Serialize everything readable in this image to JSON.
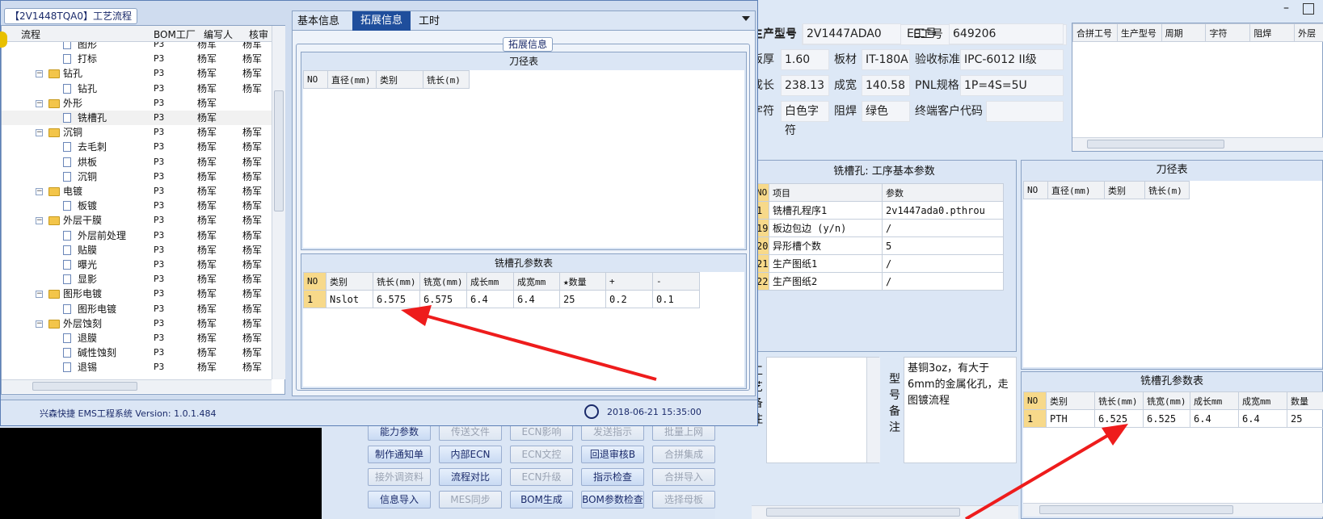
{
  "left_window": {
    "title": "【2V1448TQA0】工艺流程",
    "tree_headers": [
      "流程",
      "BOM工厂",
      "编写人",
      "核审"
    ],
    "tree_rows": [
      {
        "level": 2,
        "kind": "doc",
        "name": "图形",
        "bom": "P3",
        "writer": "杨军",
        "review": "杨军"
      },
      {
        "level": 2,
        "kind": "doc",
        "name": "打标",
        "bom": "P3",
        "writer": "杨军",
        "review": "杨军"
      },
      {
        "level": 1,
        "kind": "folder",
        "name": "钻孔",
        "bom": "P3",
        "writer": "杨军",
        "review": "杨军"
      },
      {
        "level": 2,
        "kind": "doc",
        "name": "钻孔",
        "bom": "P3",
        "writer": "杨军",
        "review": "杨军"
      },
      {
        "level": 1,
        "kind": "folder",
        "name": "外形",
        "bom": "P3",
        "writer": "杨军",
        "review": ""
      },
      {
        "level": 2,
        "kind": "doc",
        "name": "铣槽孔",
        "bom": "P3",
        "writer": "杨军",
        "review": "",
        "selected": true
      },
      {
        "level": 1,
        "kind": "folder",
        "name": "沉铜",
        "bom": "P3",
        "writer": "杨军",
        "review": "杨军"
      },
      {
        "level": 2,
        "kind": "doc",
        "name": "去毛刺",
        "bom": "P3",
        "writer": "杨军",
        "review": "杨军"
      },
      {
        "level": 2,
        "kind": "doc",
        "name": "烘板",
        "bom": "P3",
        "writer": "杨军",
        "review": "杨军"
      },
      {
        "level": 2,
        "kind": "doc",
        "name": "沉铜",
        "bom": "P3",
        "writer": "杨军",
        "review": "杨军"
      },
      {
        "level": 1,
        "kind": "folder",
        "name": "电镀",
        "bom": "P3",
        "writer": "杨军",
        "review": "杨军"
      },
      {
        "level": 2,
        "kind": "doc",
        "name": "板镀",
        "bom": "P3",
        "writer": "杨军",
        "review": "杨军"
      },
      {
        "level": 1,
        "kind": "folder",
        "name": "外层干膜",
        "bom": "P3",
        "writer": "杨军",
        "review": "杨军"
      },
      {
        "level": 2,
        "kind": "doc",
        "name": "外层前处理",
        "bom": "P3",
        "writer": "杨军",
        "review": "杨军"
      },
      {
        "level": 2,
        "kind": "doc",
        "name": "贴膜",
        "bom": "P3",
        "writer": "杨军",
        "review": "杨军"
      },
      {
        "level": 2,
        "kind": "doc",
        "name": "曝光",
        "bom": "P3",
        "writer": "杨军",
        "review": "杨军"
      },
      {
        "level": 2,
        "kind": "doc",
        "name": "显影",
        "bom": "P3",
        "writer": "杨军",
        "review": "杨军"
      },
      {
        "level": 1,
        "kind": "folder",
        "name": "图形电镀",
        "bom": "P3",
        "writer": "杨军",
        "review": "杨军"
      },
      {
        "level": 2,
        "kind": "doc",
        "name": "图形电镀",
        "bom": "P3",
        "writer": "杨军",
        "review": "杨军"
      },
      {
        "level": 1,
        "kind": "folder",
        "name": "外层蚀刻",
        "bom": "P3",
        "writer": "杨军",
        "review": "杨军"
      },
      {
        "level": 2,
        "kind": "doc",
        "name": "退膜",
        "bom": "P3",
        "writer": "杨军",
        "review": "杨军"
      },
      {
        "level": 2,
        "kind": "doc",
        "name": "碱性蚀刻",
        "bom": "P3",
        "writer": "杨军",
        "review": "杨军"
      },
      {
        "level": 2,
        "kind": "doc",
        "name": "退锡",
        "bom": "P3",
        "writer": "杨军",
        "review": "杨军"
      }
    ],
    "tabs": [
      "基本信息",
      "拓展信息",
      "工时"
    ],
    "active_tab": "拓展信息",
    "group_title": "拓展信息",
    "cutter_table": {
      "title": "刀径表",
      "headers": [
        "NO",
        "直径(mm)",
        "类别",
        "铣长(m)"
      ]
    },
    "slot_table": {
      "title": "铣槽孔参数表",
      "headers": [
        "NO",
        "类别",
        "铣长(mm)",
        "铣宽(mm)",
        "成长mm",
        "成宽mm",
        "★数量",
        "+",
        "-"
      ],
      "rows": [
        [
          "1",
          "Nslot",
          "6.575",
          "6.575",
          "6.4",
          "6.4",
          "25",
          "0.2",
          "0.1"
        ]
      ]
    },
    "status_app": "兴森快捷 EMS工程系统 Version: 1.0.1.484",
    "status_time": "2018-06-21 15:35:00"
  },
  "right_form": {
    "labels": {
      "model": "生产型号",
      "eid": "E工号",
      "thickness": "板厚",
      "material": "板材",
      "standard": "验收标准",
      "length": "成长",
      "width": "成宽",
      "pnl": "PNL规格",
      "silkscreen": "字符",
      "mask": "阻焊",
      "customer": "终端客户代码"
    },
    "values": {
      "model": "2V1447ADA0",
      "eid": "649206",
      "thickness": "1.60",
      "material": "IT-180A",
      "standard": "IPC-6012 II级",
      "length": "238.13",
      "width": "140.58",
      "pnl": "1P=4S=5U",
      "silkscreen": "白色字符",
      "mask": "绿色",
      "customer": ""
    }
  },
  "merge_table": {
    "headers": [
      "合拼工号",
      "生产型号",
      "周期",
      "字符",
      "阻焊",
      "外层"
    ]
  },
  "basic_params": {
    "title": "铣槽孔: 工序基本参数",
    "headers": [
      "NO",
      "项目",
      "参数"
    ],
    "rows": [
      [
        "1",
        "铣槽孔程序1",
        "2v1447ada0.pthrou"
      ],
      [
        "19",
        "板边包边 (y/n)",
        "/"
      ],
      [
        "20",
        "异形槽个数",
        "5"
      ],
      [
        "21",
        "生产图纸1",
        "/"
      ],
      [
        "22",
        "生产图纸2",
        "/"
      ]
    ]
  },
  "right_cutter": {
    "title": "刀径表",
    "headers": [
      "NO",
      "直径(mm)",
      "类别",
      "铣长(m)"
    ]
  },
  "notes": {
    "process_label": "工艺备注",
    "model_label": "型号备注",
    "model_note": "基铜3oz，有大于6mm的金属化孔，走图镀流程"
  },
  "right_slot": {
    "title": "铣槽孔参数表",
    "headers": [
      "NO",
      "类别",
      "铣长(mm)",
      "铣宽(mm)",
      "成长mm",
      "成宽mm",
      "数量"
    ],
    "rows": [
      [
        "1",
        "PTH",
        "6.525",
        "6.525",
        "6.4",
        "6.4",
        "25"
      ]
    ]
  },
  "buttons": [
    {
      "label": "能力参数",
      "enabled": true
    },
    {
      "label": "传送文件",
      "enabled": false
    },
    {
      "label": "ECN影响",
      "enabled": false
    },
    {
      "label": "发送指示",
      "enabled": false
    },
    {
      "label": "批量上网",
      "enabled": false
    },
    {
      "label": "制作通知单",
      "enabled": true
    },
    {
      "label": "内部ECN",
      "enabled": true
    },
    {
      "label": "ECN文控",
      "enabled": false
    },
    {
      "label": "回退审核B",
      "enabled": true
    },
    {
      "label": "合拼集成",
      "enabled": false
    },
    {
      "label": "接外调资料",
      "enabled": false
    },
    {
      "label": "流程对比",
      "enabled": true
    },
    {
      "label": "ECN升级",
      "enabled": false
    },
    {
      "label": "指示检查",
      "enabled": true
    },
    {
      "label": "合拼导入",
      "enabled": false
    },
    {
      "label": "信息导入",
      "enabled": true
    },
    {
      "label": "MES同步",
      "enabled": false
    },
    {
      "label": "BOM生成",
      "enabled": true
    },
    {
      "label": "BOM参数检查",
      "enabled": true
    },
    {
      "label": "选择母板",
      "enabled": false
    }
  ],
  "colors": {
    "arrow": "#ee1c1c",
    "tab_active": "#1f4e9c",
    "header_yellow": "#f7d98a"
  }
}
